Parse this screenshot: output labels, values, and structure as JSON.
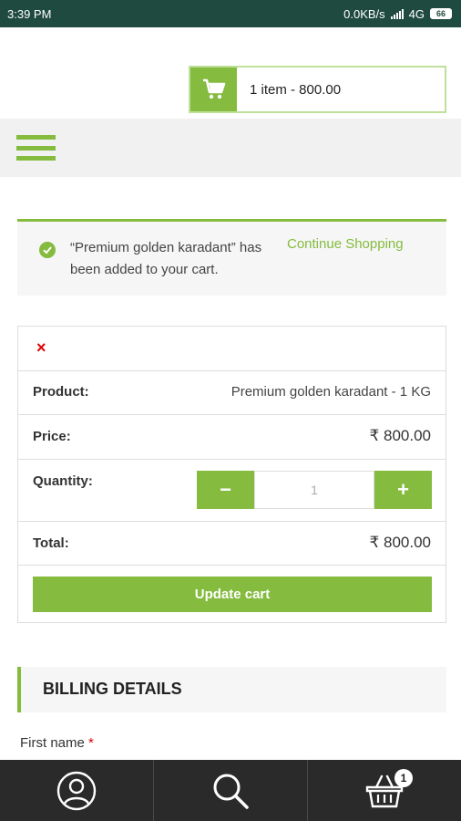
{
  "status_bar": {
    "time": "3:39 PM",
    "network_speed": "0.0KB/s",
    "network_type": "4G",
    "battery": "66"
  },
  "cart_summary": {
    "text": "1 item - 800.00",
    "icon": "shopping-cart-icon"
  },
  "notice": {
    "message": "“Premium golden karadant” has been added to your cart.",
    "continue_label": "Continue Shopping",
    "icon": "check-circle-icon"
  },
  "cart": {
    "remove_symbol": "×",
    "product_label": "Product:",
    "product_value": "Premium golden karadant - 1 KG",
    "price_label": "Price:",
    "price_value": "₹ 800.00",
    "quantity_label": "Quantity:",
    "minus_label": "−",
    "plus_label": "+",
    "quantity_value": "1",
    "total_label": "Total:",
    "total_value": "₹ 800.00",
    "update_label": "Update cart"
  },
  "billing": {
    "title": "BILLING DETAILS",
    "first_name_label": "First name",
    "required_mark": "*"
  },
  "bottom_nav": {
    "items": [
      "account-icon",
      "search-icon",
      "basket-icon"
    ],
    "cart_badge": "1"
  },
  "colors": {
    "accent": "#85bb3f",
    "status_bar": "#1f4a3f",
    "bottom_bar": "#2a2a2a",
    "error": "#e00000"
  }
}
